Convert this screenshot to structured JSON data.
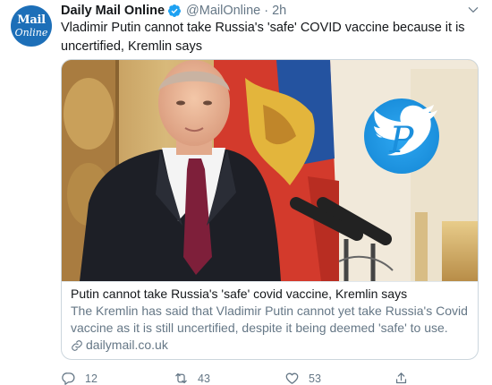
{
  "account": {
    "avatar_line1": "Mail",
    "avatar_line2": "Online",
    "display_name": "Daily Mail Online",
    "handle": "@MailOnline",
    "separator": "·",
    "timestamp": "2h",
    "verified": true
  },
  "tweet": {
    "text": "Vladimir Putin cannot take Russia's 'safe' COVID vaccine because it is uncertified, Kremlin says"
  },
  "card": {
    "title": "Putin cannot take Russia's 'safe' covid vaccine, Kremlin says",
    "description": "The Kremlin has said that Vladimir Putin cannot yet take Russia's Covid vaccine as it is still uncertified, despite it being deemed 'safe' to use.",
    "domain": "dailymail.co.uk",
    "watermark_letter": "P"
  },
  "actions": {
    "replies": "12",
    "retweets": "43",
    "likes": "53"
  },
  "colors": {
    "brand": "#1da1f2",
    "avatar_bg": "#1d6fb8",
    "text_primary": "#14171a",
    "text_secondary": "#657786",
    "border": "#ccd6dd"
  },
  "icons": {
    "verified": "verified-badge-icon",
    "more": "chevron-down-icon",
    "link": "link-icon",
    "reply": "reply-icon",
    "retweet": "retweet-icon",
    "like": "heart-icon",
    "share": "share-icon"
  }
}
